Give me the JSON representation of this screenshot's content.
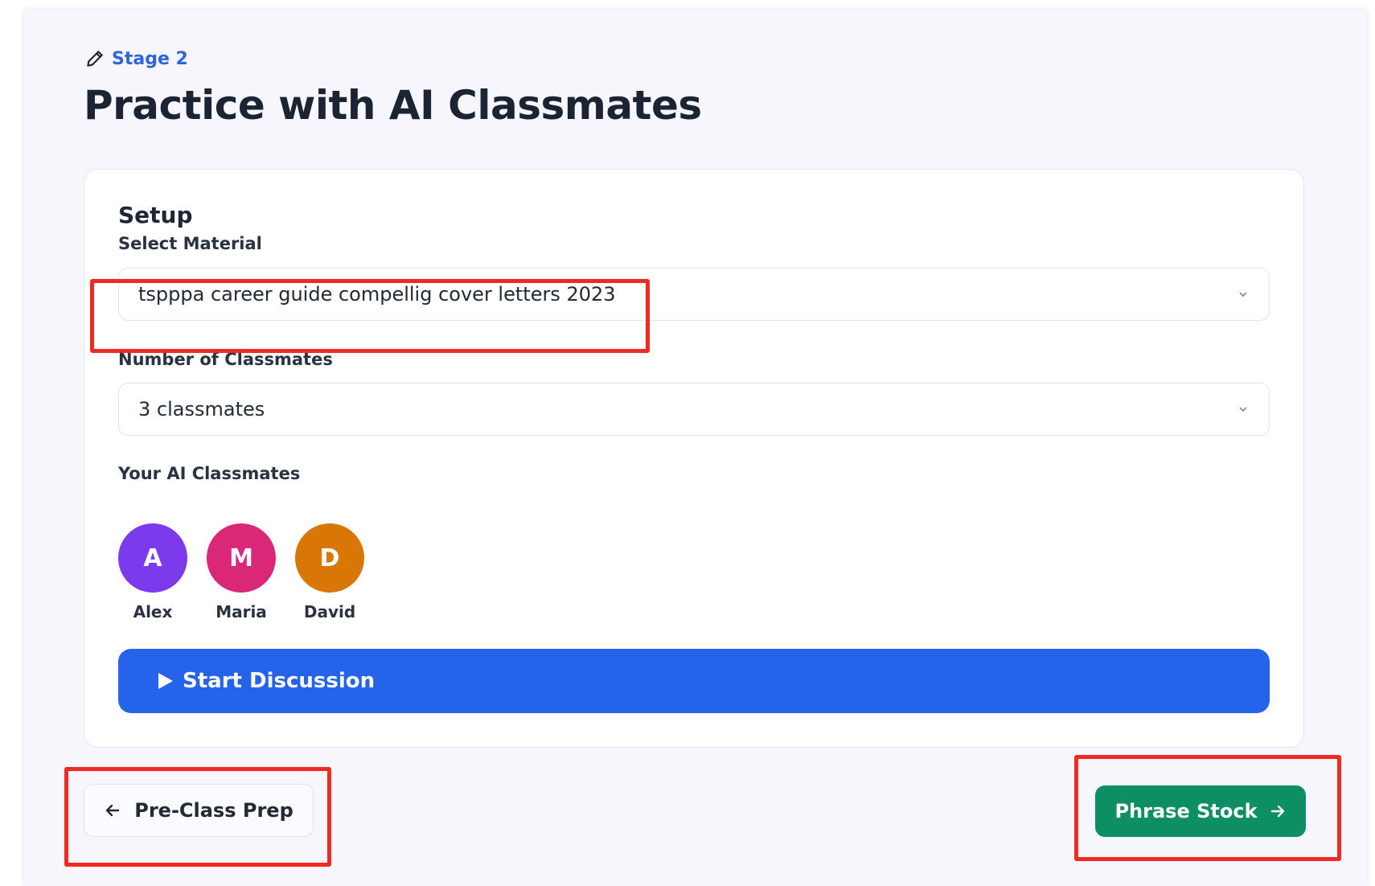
{
  "stage": {
    "label": "Stage 2"
  },
  "page": {
    "title": "Practice with AI Classmates"
  },
  "setup": {
    "heading": "Setup",
    "material": {
      "label": "Select Material",
      "value": "tspppa career guide compellig cover letters 2023"
    },
    "classmates": {
      "label": "Number of Classmates",
      "value": "3 classmates"
    },
    "ai_classmates": {
      "label": "Your AI Classmates",
      "list": [
        {
          "initial": "A",
          "name": "Alex",
          "color": "#7c3aed"
        },
        {
          "initial": "M",
          "name": "Maria",
          "color": "#db2777"
        },
        {
          "initial": "D",
          "name": "David",
          "color": "#d97706"
        }
      ]
    },
    "start_label": "Start Discussion"
  },
  "nav": {
    "prev_label": "Pre-Class Prep",
    "next_label": "Phrase Stock"
  },
  "colors": {
    "accent": "#2563eb",
    "next": "#0d8f63",
    "highlight": "#ee2a22"
  }
}
